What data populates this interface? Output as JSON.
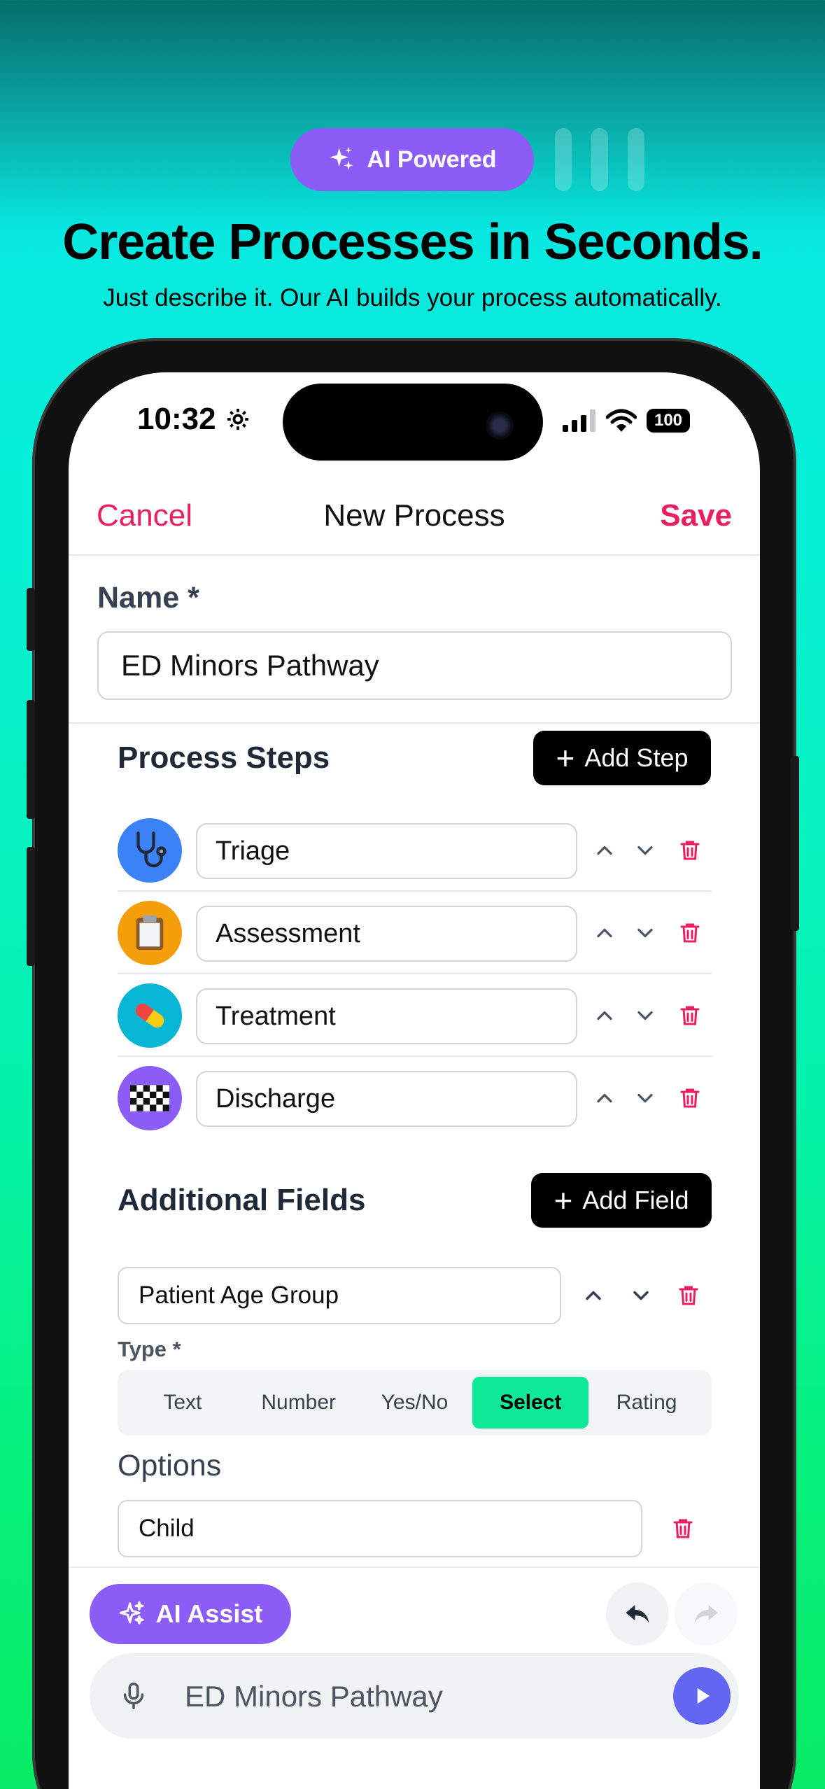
{
  "promo": {
    "badge_label": "AI Powered",
    "headline": "Create Processes in Seconds.",
    "subline": "Just describe it. Our AI builds your process automatically."
  },
  "status_bar": {
    "time": "10:32",
    "battery": "100"
  },
  "nav": {
    "cancel": "Cancel",
    "title": "New Process",
    "save": "Save"
  },
  "name_field": {
    "label": "Name *",
    "value": "ED Minors Pathway"
  },
  "process_steps": {
    "title": "Process Steps",
    "add_label": "Add Step",
    "steps": [
      {
        "label": "Triage",
        "icon": "stethoscope-icon",
        "color": "#3b82f6"
      },
      {
        "label": "Assessment",
        "icon": "clipboard-icon",
        "color": "#f59e0b"
      },
      {
        "label": "Treatment",
        "icon": "pill-icon",
        "color": "#06b6d4"
      },
      {
        "label": "Discharge",
        "icon": "checkered-flag-icon",
        "color": "#8b5cf6"
      }
    ]
  },
  "additional_fields": {
    "title": "Additional Fields",
    "add_label": "Add Field",
    "field_value": "Patient Age Group",
    "type_label": "Type *",
    "types": [
      "Text",
      "Number",
      "Yes/No",
      "Select",
      "Rating"
    ],
    "selected_type": "Select",
    "options_title": "Options",
    "options": [
      "Child"
    ]
  },
  "bottom": {
    "ai_assist_label": "AI Assist",
    "chat_value": "ED Minors Pathway"
  },
  "colors": {
    "accent_pink": "#e91e63",
    "purple": "#8b5cf6",
    "select_green": "#0ee899",
    "send_blue": "#6366f1"
  }
}
